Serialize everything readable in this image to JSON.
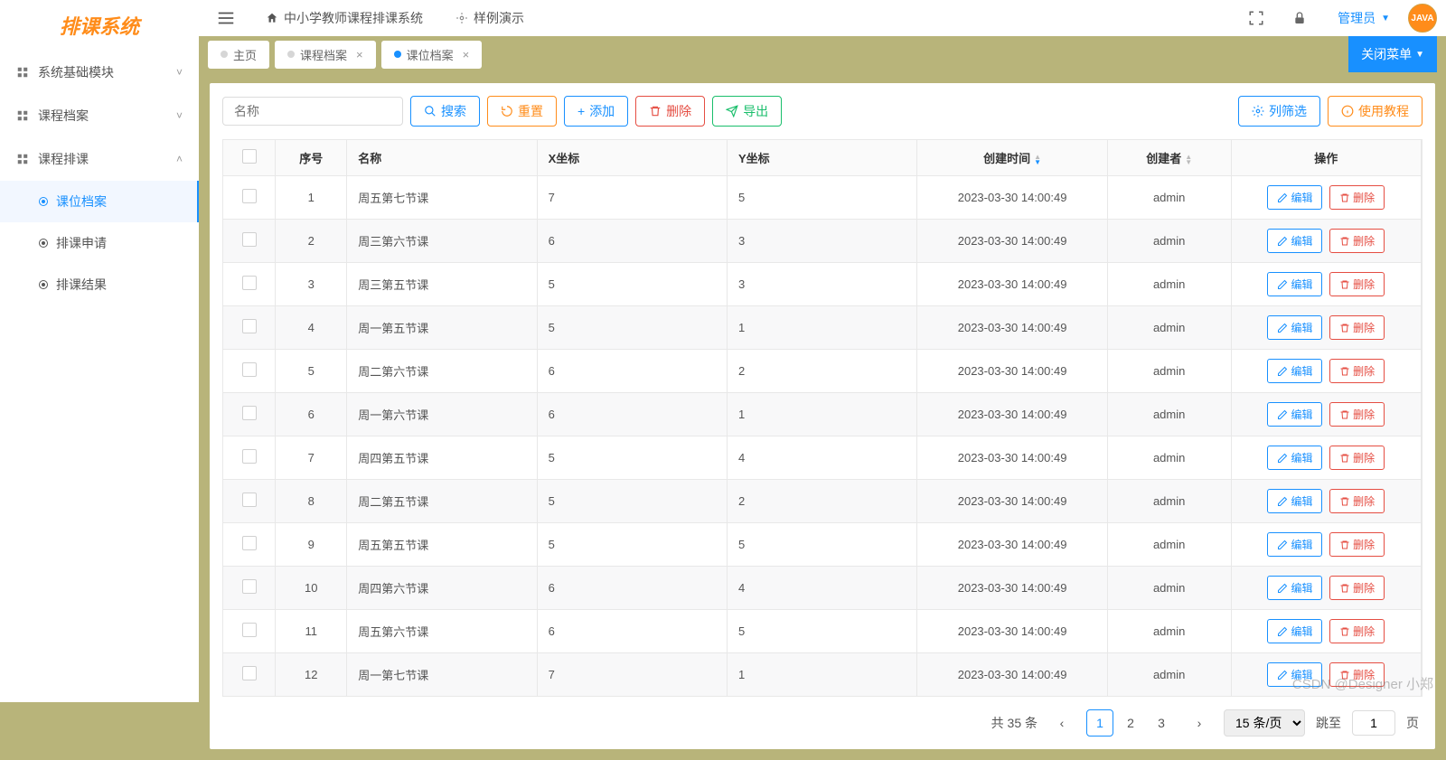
{
  "logo": "排课系统",
  "header": {
    "app_title": "中小学教师课程排课系统",
    "demo_link": "样例演示",
    "user_label": "管理员",
    "avatar_text": "JAVA"
  },
  "sidebar": {
    "groups": [
      {
        "label": "系统基础模块",
        "expanded": false
      },
      {
        "label": "课程档案",
        "expanded": false
      },
      {
        "label": "课程排课",
        "expanded": true,
        "items": [
          {
            "label": "课位档案",
            "active": true
          },
          {
            "label": "排课申请",
            "active": false
          },
          {
            "label": "排课结果",
            "active": false
          }
        ]
      }
    ]
  },
  "tabs": [
    {
      "label": "主页",
      "closable": false,
      "active": false
    },
    {
      "label": "课程档案",
      "closable": true,
      "active": false
    },
    {
      "label": "课位档案",
      "closable": true,
      "active": true
    }
  ],
  "close_menu_label": "关闭菜单",
  "toolbar": {
    "name_placeholder": "名称",
    "search": "搜索",
    "reset": "重置",
    "add": "添加",
    "delete": "删除",
    "export": "导出",
    "column_filter": "列筛选",
    "tutorial": "使用教程"
  },
  "table": {
    "headers": {
      "index": "序号",
      "name": "名称",
      "x": "X坐标",
      "y": "Y坐标",
      "created_time": "创建时间",
      "creator": "创建者",
      "ops": "操作"
    },
    "row_buttons": {
      "edit": "编辑",
      "delete": "删除"
    },
    "rows": [
      {
        "idx": "1",
        "name": "周五第七节课",
        "x": "7",
        "y": "5",
        "time": "2023-03-30 14:00:49",
        "creator": "admin"
      },
      {
        "idx": "2",
        "name": "周三第六节课",
        "x": "6",
        "y": "3",
        "time": "2023-03-30 14:00:49",
        "creator": "admin"
      },
      {
        "idx": "3",
        "name": "周三第五节课",
        "x": "5",
        "y": "3",
        "time": "2023-03-30 14:00:49",
        "creator": "admin"
      },
      {
        "idx": "4",
        "name": "周一第五节课",
        "x": "5",
        "y": "1",
        "time": "2023-03-30 14:00:49",
        "creator": "admin"
      },
      {
        "idx": "5",
        "name": "周二第六节课",
        "x": "6",
        "y": "2",
        "time": "2023-03-30 14:00:49",
        "creator": "admin"
      },
      {
        "idx": "6",
        "name": "周一第六节课",
        "x": "6",
        "y": "1",
        "time": "2023-03-30 14:00:49",
        "creator": "admin"
      },
      {
        "idx": "7",
        "name": "周四第五节课",
        "x": "5",
        "y": "4",
        "time": "2023-03-30 14:00:49",
        "creator": "admin"
      },
      {
        "idx": "8",
        "name": "周二第五节课",
        "x": "5",
        "y": "2",
        "time": "2023-03-30 14:00:49",
        "creator": "admin"
      },
      {
        "idx": "9",
        "name": "周五第五节课",
        "x": "5",
        "y": "5",
        "time": "2023-03-30 14:00:49",
        "creator": "admin"
      },
      {
        "idx": "10",
        "name": "周四第六节课",
        "x": "6",
        "y": "4",
        "time": "2023-03-30 14:00:49",
        "creator": "admin"
      },
      {
        "idx": "11",
        "name": "周五第六节课",
        "x": "6",
        "y": "5",
        "time": "2023-03-30 14:00:49",
        "creator": "admin"
      },
      {
        "idx": "12",
        "name": "周一第七节课",
        "x": "7",
        "y": "1",
        "time": "2023-03-30 14:00:49",
        "creator": "admin"
      }
    ]
  },
  "pagination": {
    "total_text": "共 35 条",
    "pages": [
      "1",
      "2",
      "3"
    ],
    "current": "1",
    "per_page": "15 条/页",
    "jump_label": "跳至",
    "jump_value": "1",
    "page_suffix": "页"
  },
  "watermark": "CSDN @Designer 小郑"
}
